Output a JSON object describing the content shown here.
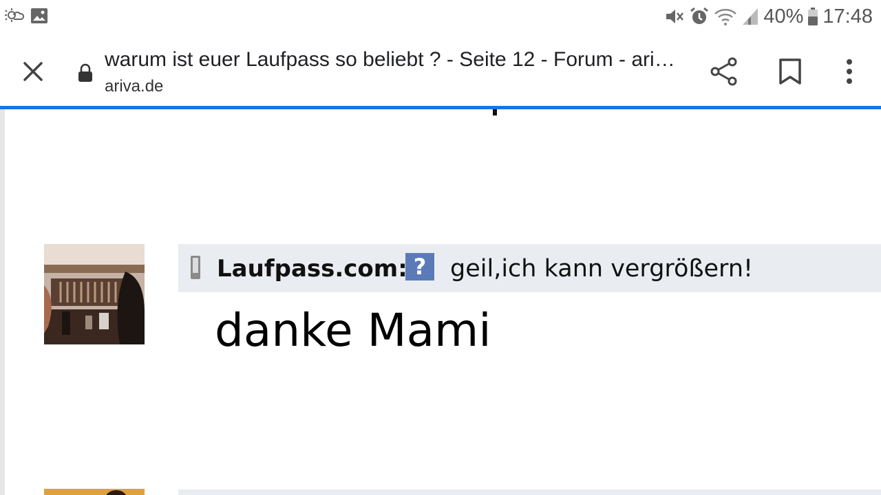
{
  "status_bar": {
    "battery_percent": "40%",
    "time": "17:48",
    "icons": [
      "weather-icon",
      "image-icon",
      "mute-icon",
      "alarm-icon",
      "wifi-icon",
      "signal-icon",
      "battery-icon"
    ]
  },
  "toolbar": {
    "page_title": "warum ist euer Laufpass so beliebt ? - Seite 12 - Forum - ariva.de",
    "domain": "ariva.de",
    "icons": [
      "close-icon",
      "lock-icon",
      "share-icon",
      "bookmark-icon",
      "more-vert-icon"
    ]
  },
  "colors": {
    "progress_bar": "#1a73e8",
    "post_header_bg": "#e9edf1",
    "help_icon_bg": "#5b7bb8"
  },
  "post": {
    "author": "Laufpass.com:",
    "subject": "geil,ich kann vergrößern!",
    "body": "danke Mami"
  }
}
